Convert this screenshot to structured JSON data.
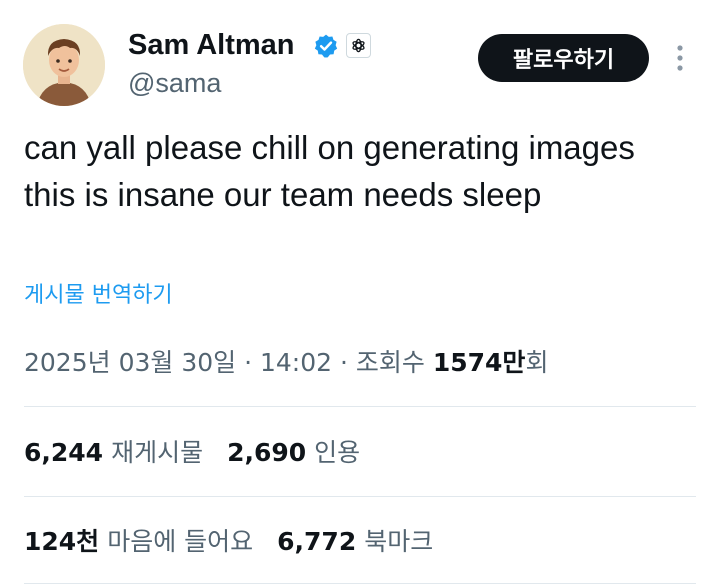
{
  "author": {
    "display_name": "Sam Altman",
    "handle": "@sama",
    "verified_icon": "verified-badge-icon",
    "affiliate_icon": "openai-logo-icon",
    "avatar_icon": "avatar-illustration"
  },
  "follow_button": {
    "label": "팔로우하기"
  },
  "more_icon": "more-vertical-icon",
  "tweet": {
    "text": "can yall please chill on generating images this is insane our team needs sleep",
    "translate_label": "게시물 번역하기"
  },
  "meta": {
    "date": "2025년 03월 30일",
    "separator": " · ",
    "time": "14:02",
    "views_label": "조회수",
    "views_count": "1574만",
    "views_suffix": "회"
  },
  "stats_row1": [
    {
      "count": "6,244",
      "label": "재게시물"
    },
    {
      "count": "2,690",
      "label": "인용"
    }
  ],
  "stats_row2": [
    {
      "count": "124천",
      "label": "마음에 들어요"
    },
    {
      "count": "6,772",
      "label": "북마크"
    }
  ],
  "colors": {
    "text_primary": "#0f1419",
    "text_secondary": "#536471",
    "link_blue": "#1d9bf0",
    "verified_blue": "#1d9bf0",
    "button_bg": "#0f1419",
    "divider": "#e1e8ed"
  }
}
